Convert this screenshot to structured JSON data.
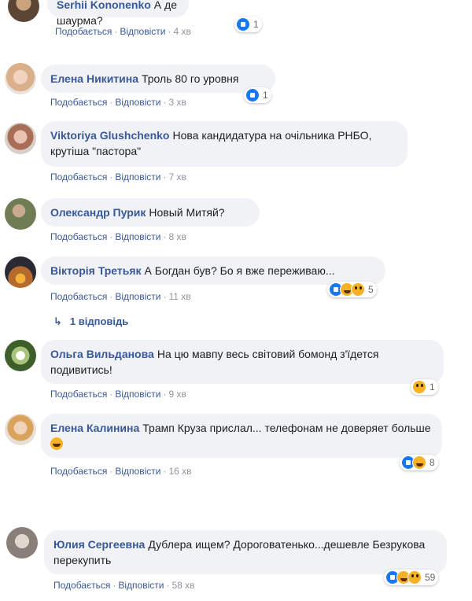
{
  "actions": {
    "like": "Подобається",
    "reply": "Відповісти",
    "dot": "·"
  },
  "comments": [
    {
      "author": "Serhii Kononenko",
      "text": "А де шаурма?",
      "time": "4 хв",
      "reaction_count": "1"
    },
    {
      "author": "Елена Никитина",
      "text": "Троль 80 го уровня",
      "time": "3 хв",
      "reaction_count": "1"
    },
    {
      "author": "Viktoriya Glushchenko",
      "text": "Нова кандидатура на очільника РНБО, крутіша \"пастора\"",
      "time": "7 хв"
    },
    {
      "author": "Олександр Пурик",
      "text": "Новый Митяй?",
      "time": "8 хв"
    },
    {
      "author": "Вікторія Третьяк",
      "text": "А Богдан був? Бо я вже переживаю...",
      "time": "11 хв",
      "reaction_count": "5",
      "replies_label": "1 відповідь"
    },
    {
      "author": "Ольга Вильданова",
      "text": "На цю мавпу весь світовий бомонд з'їдется подивитись!",
      "time": "9 хв",
      "reaction_count": "1"
    },
    {
      "author": "Елена Калинина",
      "text": "Трамп Круза прислал... телефонам не доверяет больше",
      "time": "16 хв",
      "reaction_count": "8"
    },
    {
      "author": "Юлия Сергеевна",
      "text": "Дублера ищем? Дороговатенько...дешевле Безрукова перекупить",
      "time": "58 хв",
      "reaction_count": "59"
    }
  ],
  "colors": {
    "link": "#385898",
    "bubble": "#f0f2f5",
    "like": "#1877f2",
    "emoji": "#f7b125"
  }
}
